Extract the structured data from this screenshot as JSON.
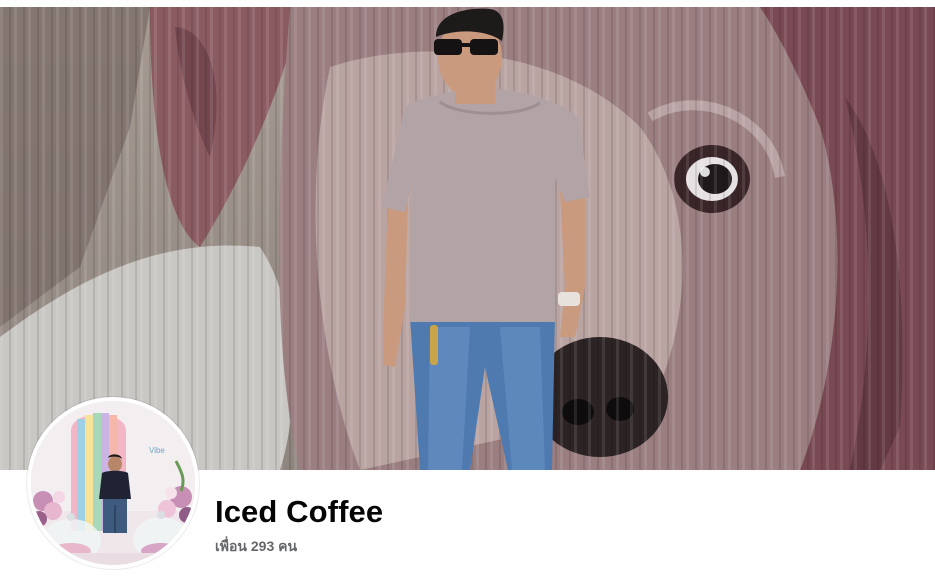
{
  "profile": {
    "name": "Iced Coffee",
    "friends_count_label": "เพื่อน 293 คน"
  },
  "images": {
    "cover": "cover photo: man in grey t-shirt and sunglasses in front of a painted dog mural on corrugated metal",
    "avatar": "profile photo: man standing in front of a pastel rainbow arch with flowers"
  },
  "colors": {
    "name_text": "#050505",
    "secondary_text": "#65676b",
    "background": "#ffffff"
  }
}
